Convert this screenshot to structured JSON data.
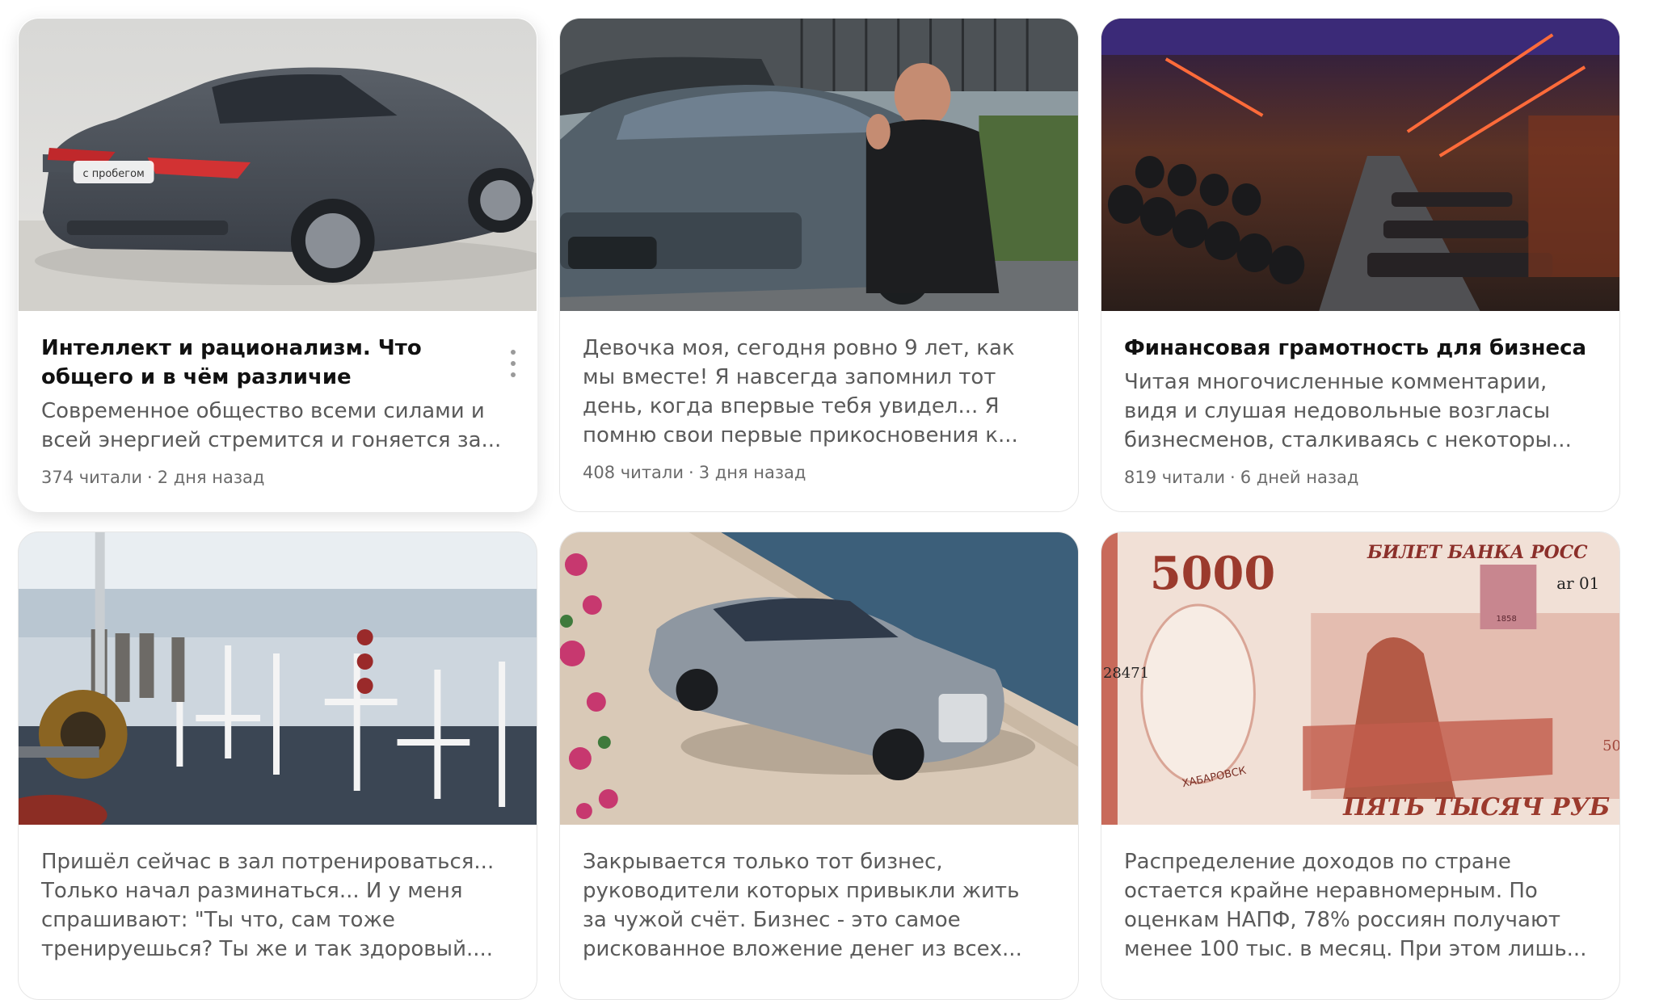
{
  "cards": [
    {
      "title": "Интеллект и рационализм. Что общего и в чём различие",
      "snippet": "Современное общество всеми силами и всей энергией стремится и гоняется за...",
      "reads": "374 читали",
      "date": "2 дня назад",
      "image": "grey-sedan-showroom",
      "image_badge": "с пробегом",
      "has_menu": true
    },
    {
      "title": "",
      "snippet": "Девочка моя, сегодня ровно 9 лет, как мы вместе! Я навсегда запомнил тот день, когда впервые тебя увидел... Я помню свои первые прикосновения к...",
      "reads": "408 читали",
      "date": "3 дня назад",
      "image": "man-with-car-thumbs-up"
    },
    {
      "title": "Финансовая грамотность для бизнеса",
      "snippet": "Читая многочисленные комментарии, видя и слушая недовольные возгласы бизнесменов, сталкиваясь с некоторы...",
      "reads": "819 читали",
      "date": "6 дней назад",
      "image": "dark-gym-dumbbells"
    },
    {
      "title": "",
      "snippet": "Пришёл сейчас в зал потренироваться... Только начал разминаться... И у меня спрашивают: \"Ты что, сам тоже тренируешься? Ты же и так здоровый....",
      "image": "bright-gym-machines"
    },
    {
      "title": "",
      "snippet": "Закрывается только тот бизнес, руководители которых привыкли жить за чужой счёт. Бизнес - это самое рискованное вложение денег из всех...",
      "image": "luxury-car-waterfront"
    },
    {
      "title": "",
      "snippet": "Распределение доходов по стране остается крайне неравномерным. По оценкам НАПФ, 78% россиян получают менее 100 тыс. в месяц. При этом лишь...",
      "image": "banknote-5000",
      "image_text": {
        "value": "5000",
        "header": "БИЛЕТ БАНКА РОСС",
        "serial": "ar 01",
        "serial_side": "28471",
        "city": "ХАБАРОВСК",
        "footer": "ПЯТЬ ТЫСЯЧ РУБ",
        "year": "1858",
        "edge": "50"
      }
    }
  ],
  "colors": {
    "title": "#111111",
    "snippet": "#5a5a5a",
    "meta": "#6b6b6b",
    "border": "#e6e6e6"
  }
}
